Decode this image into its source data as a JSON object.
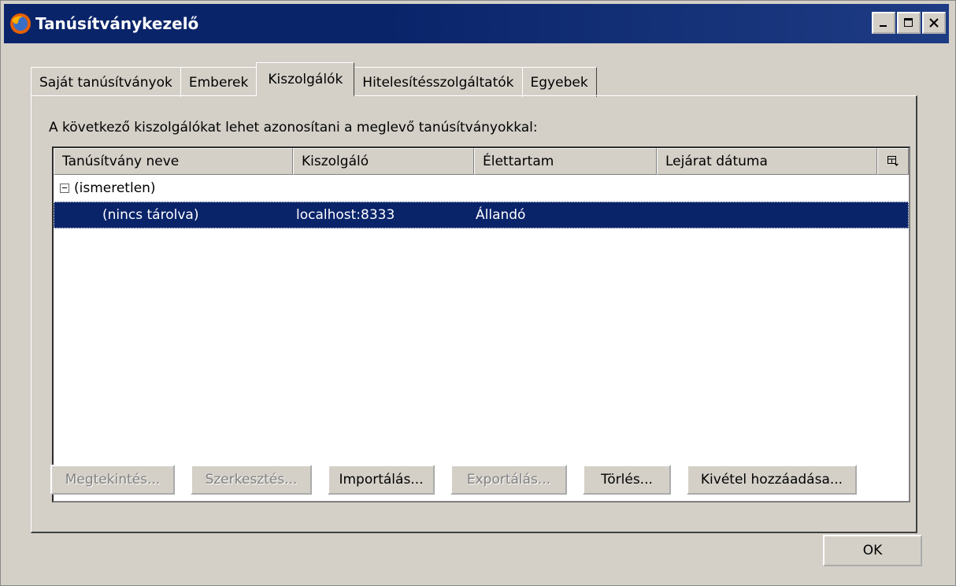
{
  "window": {
    "title": "Tanúsítványkezelő"
  },
  "tabs": [
    {
      "label": "Saját tanúsítványok"
    },
    {
      "label": "Emberek"
    },
    {
      "label": "Kiszolgálók"
    },
    {
      "label": "Hitelesítésszolgáltatók"
    },
    {
      "label": "Egyebek"
    }
  ],
  "panel": {
    "description": "A következő kiszolgálókat lehet azonosítani a meglevő tanúsítványokkal:"
  },
  "table": {
    "columns": [
      "Tanúsítvány neve",
      "Kiszolgáló",
      "Élettartam",
      "Lejárat dátuma"
    ],
    "group": {
      "label": "(ismeretlen)"
    },
    "rows": [
      {
        "name": "(nincs tárolva)",
        "server": "localhost:8333",
        "lifetime": "Állandó",
        "expiry": ""
      }
    ]
  },
  "buttons": {
    "view": "Megtekintés...",
    "edit": "Szerkesztés...",
    "import": "Importálás...",
    "export": "Exportálás...",
    "delete": "Törlés...",
    "add_exception": "Kivétel hozzáadása...",
    "ok": "OK"
  }
}
